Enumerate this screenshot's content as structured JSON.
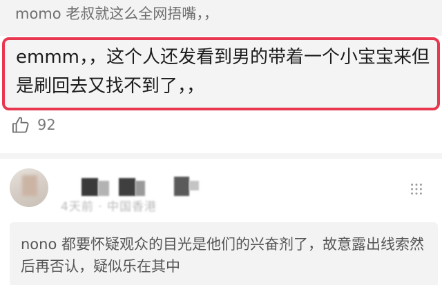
{
  "prev_reply": {
    "text": "momo 老叔就这么全网捂嘴，，"
  },
  "highlighted_comment": {
    "text": "emmm，，这个人还发看到男的带着一个小宝宝来但是刷回去又找不到了，，",
    "border_color": "#e8384f"
  },
  "likes": {
    "icon": "thumbs-up-icon",
    "count": "92"
  },
  "next_comment": {
    "meta": "4天前 · 中国香港",
    "reply_text": "nono 都要怀疑观众的目光是他们的兴奋剂了，故意露出线索然后再否认，疑似乐在其中"
  }
}
